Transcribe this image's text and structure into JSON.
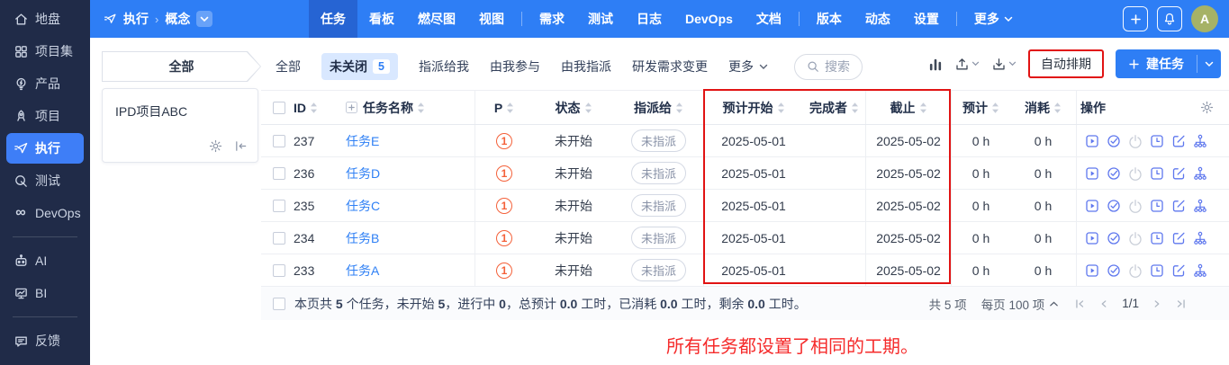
{
  "colors": {
    "accent": "#2e7ef5",
    "sidebar_bg": "#202b48",
    "annotation_red": "#e11313",
    "note_red": "#f52b2b",
    "priority_orange": "#f4613a",
    "avatar_bg": "#a6b266",
    "link_blue": "#2f80f5",
    "active_filter_bg": "#d9e8ff"
  },
  "sidebar": {
    "items": [
      {
        "key": "home",
        "label": "地盘",
        "icon": "home-icon",
        "active": false
      },
      {
        "key": "program",
        "label": "项目集",
        "icon": "program-icon",
        "active": false
      },
      {
        "key": "product",
        "label": "产品",
        "icon": "product-icon",
        "active": false
      },
      {
        "key": "project",
        "label": "项目",
        "icon": "project-icon",
        "active": false
      },
      {
        "key": "execution",
        "label": "执行",
        "icon": "execution-icon",
        "active": true
      },
      {
        "key": "qa",
        "label": "测试",
        "icon": "qa-icon",
        "active": false
      },
      {
        "key": "devops",
        "label": "DevOps",
        "icon": "devops-icon",
        "active": false
      },
      {
        "divider": true
      },
      {
        "key": "ai",
        "label": "AI",
        "icon": "ai-icon",
        "active": false
      },
      {
        "key": "bi",
        "label": "BI",
        "icon": "bi-icon",
        "active": false
      },
      {
        "divider": true
      },
      {
        "key": "feedback",
        "label": "反馈",
        "icon": "feedback-icon",
        "active": false
      }
    ]
  },
  "topnav": {
    "breadcrumb": {
      "module": "执行",
      "separator": "›",
      "project": "概念"
    },
    "tabs": [
      {
        "key": "task",
        "label": "任务",
        "active": true
      },
      {
        "key": "kanban",
        "label": "看板"
      },
      {
        "key": "burndown",
        "label": "燃尽图"
      },
      {
        "key": "view",
        "label": "视图"
      },
      {
        "divider": true
      },
      {
        "key": "story",
        "label": "需求"
      },
      {
        "key": "test",
        "label": "测试"
      },
      {
        "key": "log",
        "label": "日志"
      },
      {
        "key": "devops",
        "label": "DevOps"
      },
      {
        "key": "doc",
        "label": "文档"
      },
      {
        "divider": true
      },
      {
        "key": "build",
        "label": "版本"
      },
      {
        "key": "dynamic",
        "label": "动态"
      },
      {
        "key": "setting",
        "label": "设置"
      },
      {
        "divider": true
      },
      {
        "key": "more",
        "label": "更多",
        "dropdown": true
      }
    ],
    "avatar": "A"
  },
  "toolbar": {
    "scope_tab": "全部",
    "filters": [
      {
        "key": "all",
        "label": "全部"
      },
      {
        "key": "unclosed",
        "label": "未关闭",
        "badge": "5",
        "active": true
      },
      {
        "key": "assigned-to-me",
        "label": "指派给我"
      },
      {
        "key": "involved-by-me",
        "label": "由我参与"
      },
      {
        "key": "assigned-by-me",
        "label": "由我指派"
      },
      {
        "key": "story-change",
        "label": "研发需求变更"
      },
      {
        "key": "more",
        "label": "更多",
        "dropdown": true
      }
    ],
    "search_placeholder": "搜索",
    "auto_schedule_label": "自动排期",
    "create_task_label": "建任务"
  },
  "project_card": {
    "name": "IPD项目ABC"
  },
  "table": {
    "columns": [
      {
        "key": "id",
        "label": "ID",
        "sortable": true
      },
      {
        "key": "name",
        "label": "任务名称",
        "sortable": true,
        "expandable": true
      },
      {
        "key": "pri",
        "label": "P",
        "sortable": true
      },
      {
        "key": "status",
        "label": "状态",
        "sortable": true
      },
      {
        "key": "assignee",
        "label": "指派给",
        "sortable": true
      },
      {
        "key": "est_start",
        "label": "预计开始",
        "sortable": true
      },
      {
        "key": "finished_by",
        "label": "完成者",
        "sortable": true
      },
      {
        "key": "deadline",
        "label": "截止",
        "sortable": true
      },
      {
        "key": "estimate",
        "label": "预计",
        "sortable": true
      },
      {
        "key": "consumed",
        "label": "消耗",
        "sortable": true
      },
      {
        "key": "actions",
        "label": "操作",
        "sortable": false
      }
    ],
    "action_icons": [
      {
        "name": "start-icon",
        "disabled": false
      },
      {
        "name": "finish-icon",
        "disabled": false
      },
      {
        "name": "close-icon",
        "disabled": true
      },
      {
        "name": "log-effort-icon",
        "disabled": false
      },
      {
        "name": "edit-icon",
        "disabled": false
      },
      {
        "name": "subdivide-icon",
        "disabled": false
      }
    ],
    "rows": [
      {
        "id": "237",
        "name": "任务E",
        "pri": "1",
        "status": "未开始",
        "assignee": "未指派",
        "est_start": "2025-05-01",
        "finished_by": "",
        "deadline": "2025-05-02",
        "estimate": "0 h",
        "consumed": "0 h"
      },
      {
        "id": "236",
        "name": "任务D",
        "pri": "1",
        "status": "未开始",
        "assignee": "未指派",
        "est_start": "2025-05-01",
        "finished_by": "",
        "deadline": "2025-05-02",
        "estimate": "0 h",
        "consumed": "0 h"
      },
      {
        "id": "235",
        "name": "任务C",
        "pri": "1",
        "status": "未开始",
        "assignee": "未指派",
        "est_start": "2025-05-01",
        "finished_by": "",
        "deadline": "2025-05-02",
        "estimate": "0 h",
        "consumed": "0 h"
      },
      {
        "id": "234",
        "name": "任务B",
        "pri": "1",
        "status": "未开始",
        "assignee": "未指派",
        "est_start": "2025-05-01",
        "finished_by": "",
        "deadline": "2025-05-02",
        "estimate": "0 h",
        "consumed": "0 h"
      },
      {
        "id": "233",
        "name": "任务A",
        "pri": "1",
        "status": "未开始",
        "assignee": "未指派",
        "est_start": "2025-05-01",
        "finished_by": "",
        "deadline": "2025-05-02",
        "estimate": "0 h",
        "consumed": "0 h"
      }
    ]
  },
  "footer": {
    "summary_segments": [
      {
        "text": "本页共 ",
        "bold": false
      },
      {
        "text": "5",
        "bold": true
      },
      {
        "text": " 个任务，未开始 ",
        "bold": false
      },
      {
        "text": "5",
        "bold": true
      },
      {
        "text": "，进行中 ",
        "bold": false
      },
      {
        "text": "0",
        "bold": true
      },
      {
        "text": "，总预计 ",
        "bold": false
      },
      {
        "text": "0.0",
        "bold": true
      },
      {
        "text": " 工时，已消耗 ",
        "bold": false
      },
      {
        "text": "0.0",
        "bold": true
      },
      {
        "text": " 工时，剩余 ",
        "bold": false
      },
      {
        "text": "0.0",
        "bold": true
      },
      {
        "text": " 工时。",
        "bold": false
      }
    ],
    "total_label": "共 5 项",
    "page_size_label": "每页 100 项",
    "page_indicator": "1/1"
  },
  "annotations": {
    "note": "所有任务都设置了相同的工期。"
  }
}
